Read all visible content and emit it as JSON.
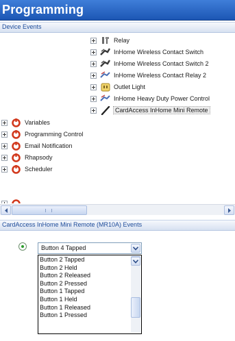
{
  "app": {
    "title": "Programming"
  },
  "device_events": {
    "header": "Device Events",
    "devices": [
      {
        "label": "Relay",
        "icon": "relay-icon"
      },
      {
        "label": "InHome Wireless Contact Switch",
        "icon": "wireless-contact-icon"
      },
      {
        "label": "InHome Wireless Contact Switch 2",
        "icon": "wireless-contact-icon"
      },
      {
        "label": "InHome Wireless Contact Relay 2",
        "icon": "wireless-relay-icon"
      },
      {
        "label": "Outlet Light",
        "icon": "outlet-light-icon"
      },
      {
        "label": "InHome Heavy Duty Power Control",
        "icon": "power-control-icon"
      },
      {
        "label": "CardAccess InHome Mini Remote",
        "icon": "remote-icon",
        "selected": true
      }
    ],
    "categories": [
      {
        "label": "Variables",
        "icon": "category-icon"
      },
      {
        "label": "Programming Control",
        "icon": "category-icon"
      },
      {
        "label": "Email Notification",
        "icon": "category-icon"
      },
      {
        "label": "Rhapsody",
        "icon": "category-icon"
      },
      {
        "label": "Scheduler",
        "icon": "category-icon"
      }
    ]
  },
  "events": {
    "header": "CardAccess InHome Mini Remote (MR10A) Events",
    "selected_event": "Button 4 Tapped",
    "options": [
      "Button 2 Tapped",
      "Button 2 Held",
      "Button 2 Released",
      "Button 2 Pressed",
      "Button 1 Tapped",
      "Button 1 Held",
      "Button 1 Released",
      "Button 1 Pressed"
    ]
  },
  "colors": {
    "title_bar": "#1c56b4",
    "category_icon": "#d23a1e",
    "radio_selected": "#2a9c2a"
  }
}
